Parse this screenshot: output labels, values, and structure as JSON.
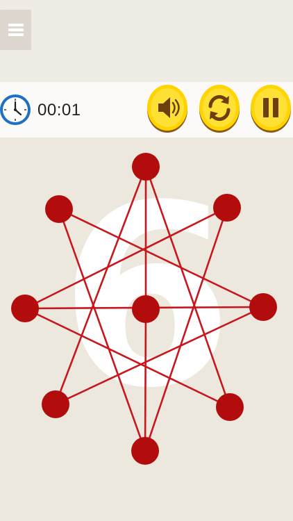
{
  "menu": {
    "icon": "hamburger-menu-icon"
  },
  "timer": {
    "icon": "clock-icon",
    "value": "00:01"
  },
  "controls": {
    "sound_icon": "speaker-icon",
    "restart_icon": "refresh-icon",
    "pause_icon": "pause-icon",
    "button_color": "#ffd400"
  },
  "level": {
    "number": "6"
  },
  "puzzle": {
    "line_color": "#c8161d",
    "node_color": "#b30c0c",
    "nodes": [
      {
        "id": "top"
      },
      {
        "id": "upper-right"
      },
      {
        "id": "right"
      },
      {
        "id": "lower-right"
      },
      {
        "id": "bottom"
      },
      {
        "id": "lower-left"
      },
      {
        "id": "left"
      },
      {
        "id": "upper-left"
      },
      {
        "id": "center"
      }
    ]
  }
}
